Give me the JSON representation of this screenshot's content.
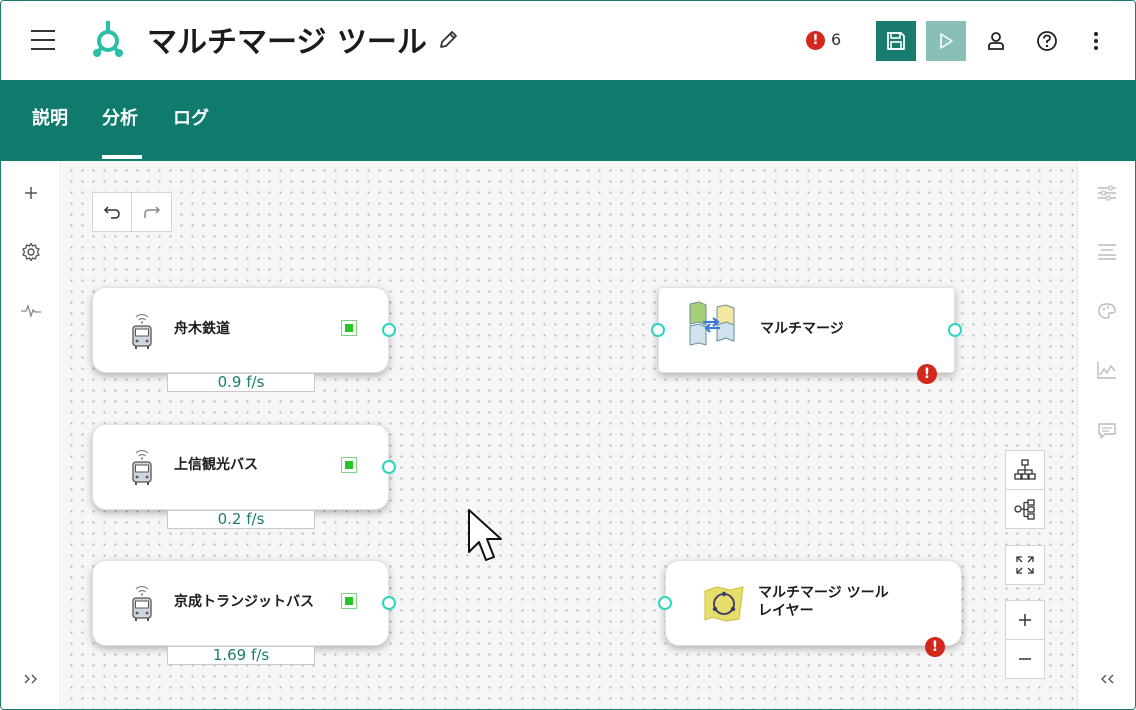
{
  "header": {
    "title": "マルチマージ ツール",
    "error_count": "6",
    "error_mark": "!"
  },
  "tabs": [
    {
      "label": "説明"
    },
    {
      "label": "分析"
    },
    {
      "label": "ログ"
    }
  ],
  "active_tab": "分析",
  "nodes": {
    "source1": {
      "label": "舟木鉄道",
      "rate": "0.9 f/s"
    },
    "source2": {
      "label": "上信観光バス",
      "rate": "0.2 f/s"
    },
    "source3": {
      "label": "京成トランジットバス",
      "rate": "1.69 f/s"
    },
    "merge": {
      "label": "マルチマージ",
      "error_mark": "!"
    },
    "output": {
      "label_line1": "マルチマージ ツール",
      "label_line2": "レイヤー",
      "error_mark": "!"
    }
  },
  "colors": {
    "accent": "#0f7b6c",
    "run_disabled": "#88bfb6",
    "error": "#d2281e",
    "port": "#2dd4c0",
    "status_ok": "#25c625"
  },
  "left_rail": {
    "icons": [
      "plus-icon",
      "gear-icon",
      "activity-icon",
      "expand-right-icon"
    ]
  },
  "right_rail": {
    "icons": [
      "sliders-icon",
      "align-icon",
      "palette-icon",
      "chart-icon",
      "comment-icon",
      "collapse-left-icon"
    ]
  }
}
